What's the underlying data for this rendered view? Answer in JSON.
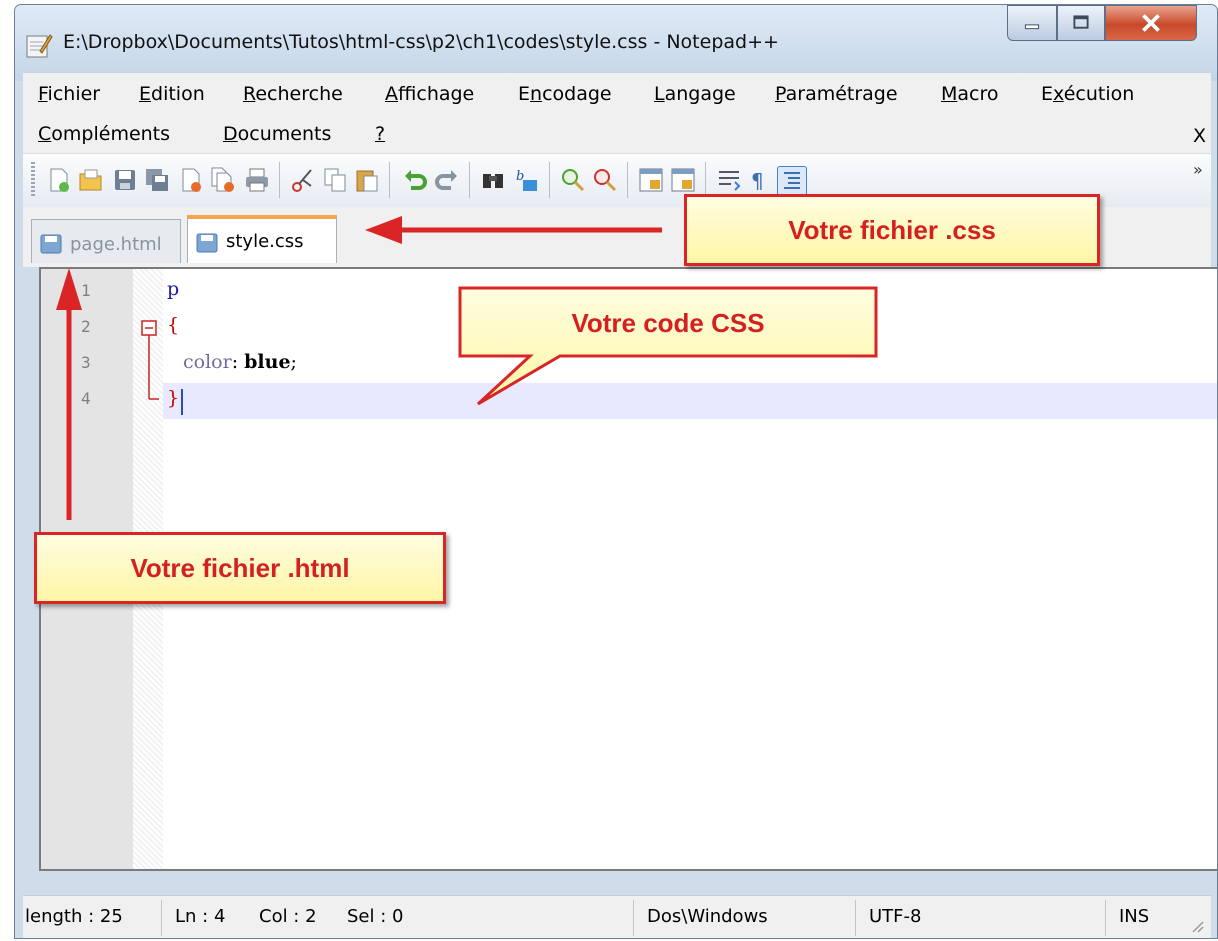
{
  "window": {
    "title": "E:\\Dropbox\\Documents\\Tutos\\html-css\\p2\\ch1\\codes\\style.css - Notepad++",
    "app_icon": "notepad-icon",
    "controls": [
      "minimize-icon",
      "maximize-icon",
      "close-icon"
    ]
  },
  "menu": {
    "items": [
      {
        "u": "F",
        "rest": "ichier"
      },
      {
        "u": "E",
        "rest": "dition"
      },
      {
        "u": "R",
        "rest": "echerche"
      },
      {
        "u": "A",
        "rest": "ffichage"
      },
      {
        "pre": "E",
        "u": "n",
        "rest": "codage"
      },
      {
        "u": "L",
        "rest": "angage"
      },
      {
        "u": "P",
        "rest": "aramétrage"
      },
      {
        "u": "M",
        "rest": "acro"
      },
      {
        "pre": "E",
        "u": "x",
        "rest": "écution"
      },
      {
        "u": "C",
        "rest": "ompléments"
      },
      {
        "u": "D",
        "rest": "ocuments"
      },
      {
        "u": "?",
        "rest": ""
      }
    ],
    "close_label": "X"
  },
  "toolbar": {
    "icons": [
      "new-file-icon",
      "open-file-icon",
      "save-icon",
      "save-all-icon",
      "close-icon",
      "close-all-icon",
      "print-icon",
      "cut-icon",
      "copy-icon",
      "paste-icon",
      "undo-icon",
      "redo-icon",
      "find-icon",
      "replace-icon",
      "zoom-in-icon",
      "zoom-out-icon",
      "sync-vertical-icon",
      "sync-horizontal-icon",
      "word-wrap-icon",
      "show-all-chars-icon",
      "indent-guide-icon"
    ],
    "more_label": "»"
  },
  "tabs": [
    {
      "label": "page.html",
      "icon": "saved-file-icon",
      "active": false
    },
    {
      "label": "style.css",
      "icon": "saved-file-icon",
      "active": true
    }
  ],
  "editor": {
    "line_numbers": [
      "1",
      "2",
      "3",
      "4"
    ],
    "lines": [
      "p",
      "{",
      "    color: blue;",
      "}"
    ],
    "colors": {
      "selector": "#1a1aa6",
      "brace": "#cc0000",
      "property": "#6e6e9e",
      "value": "#000000",
      "current_line": "#e8e8ff"
    }
  },
  "status": {
    "length": "length : 25",
    "ln": "Ln : 4",
    "col": "Col : 2",
    "sel": "Sel : 0",
    "eol": "Dos\\Windows",
    "encoding": "UTF-8",
    "mode": "INS"
  },
  "annotations": {
    "css_file": "Votre fichier .css",
    "css_code": "Votre code CSS",
    "html_file": "Votre fichier .html",
    "accent": "#d92525",
    "fill": "#fff6a6"
  }
}
